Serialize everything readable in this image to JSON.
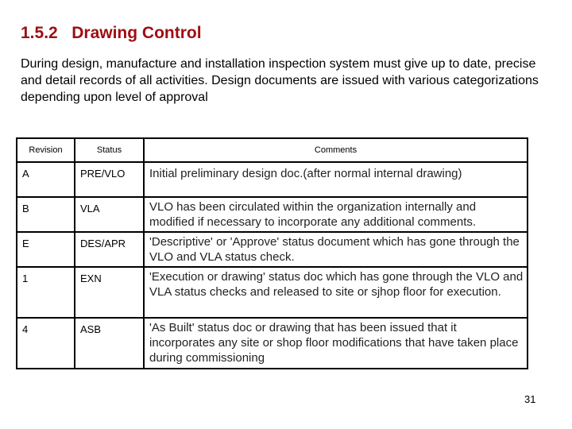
{
  "heading": {
    "number": "1.5.2",
    "title": "Drawing Control",
    "color": "#a00d12"
  },
  "intro": "During design, manufacture and installation inspection system must give up to date, precise and detail records of all activities. Design documents are issued with various categorizations depending upon level of approval",
  "table": {
    "headers": [
      "Revision",
      "Status",
      "Comments"
    ],
    "rows": [
      {
        "revision": "A",
        "status": "PRE/VLO",
        "comments": "Initial preliminary design doc.(after normal internal drawing)"
      },
      {
        "revision": "B",
        "status": "VLA",
        "comments": "VLO has been circulated within the organization internally and modified if necessary to incorporate any additional comments."
      },
      {
        "revision": "E",
        "status": "DES/APR",
        "comments": "'Descriptive' or 'Approve' status document which has gone through the VLO and VLA status check."
      },
      {
        "revision": "1",
        "status": "EXN",
        "comments": "'Execution or drawing' status doc which has gone through the VLO and VLA status checks and released to site or sjhop floor for execution."
      },
      {
        "revision": "4",
        "status": "ASB",
        "comments": "'As Built' status doc or drawing that has been issued that it incorporates any site or shop floor modifications that have taken place during commissioning"
      }
    ]
  },
  "page_number": "31"
}
